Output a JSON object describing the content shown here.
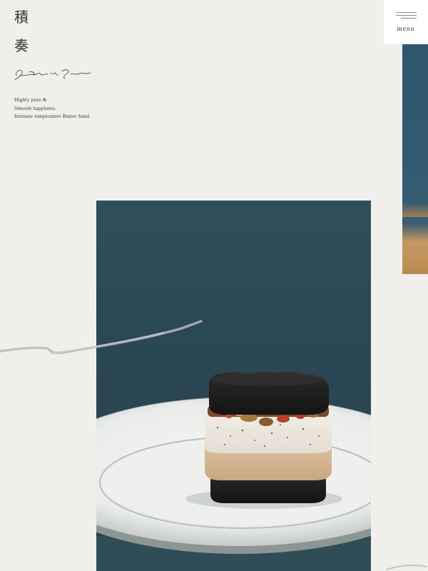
{
  "brand": {
    "kanji": [
      "積",
      "奏"
    ],
    "signature_alt": "Sekisou"
  },
  "tagline": {
    "lines": [
      "Highly pure &",
      "Smooth happiness.",
      "Intimate temperature Butter Sand."
    ]
  },
  "menu": {
    "label": "menu"
  },
  "colors": {
    "background": "#f1efeb",
    "photo_teal": "#2b4a55",
    "menu_bg": "#ffffff"
  },
  "icons": {
    "menu": "hamburger-icon",
    "signature": "signature-logo"
  }
}
